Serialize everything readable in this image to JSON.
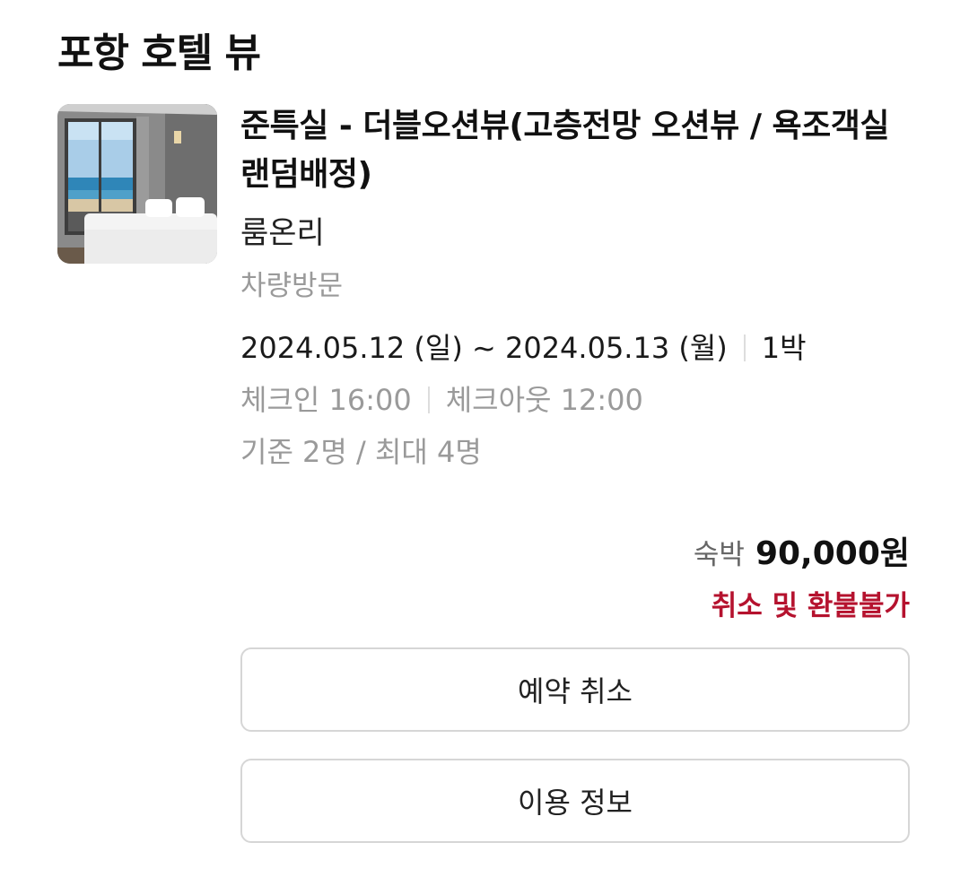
{
  "header": {
    "hotel_name": "포항 호텔 뷰"
  },
  "booking": {
    "room_name": "준특실 - 더블오션뷰(고층전망 오션뷰 / 욕조객실 랜덤배정)",
    "room_type": "룸온리",
    "visit_method": "차량방문",
    "checkin_date": "2024.05.12 (일)",
    "date_separator": "~",
    "checkout_date": "2024.05.13 (월)",
    "nights": "1박",
    "checkin_time": "체크인 16:00",
    "checkout_time": "체크아웃 12:00",
    "capacity": "기준 2명 / 최대 4명"
  },
  "price": {
    "label": "숙박",
    "amount": "90,000원",
    "refund_policy": "취소 및 환불불가"
  },
  "actions": {
    "cancel_label": "예약 취소",
    "info_label": "이용 정보"
  },
  "colors": {
    "refund_policy": "#b5122e",
    "secondary_text": "#9a9a9a",
    "button_border": "#d6d6d6"
  }
}
